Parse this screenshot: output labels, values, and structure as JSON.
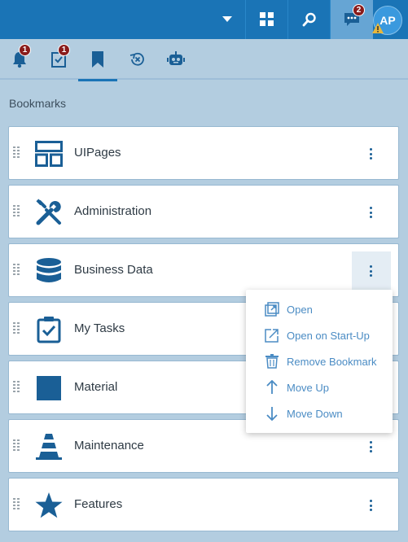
{
  "topbar": {
    "chat_badge": "2",
    "avatar_initials": "AP"
  },
  "tabs": [
    {
      "name": "notifications",
      "badge": "1"
    },
    {
      "name": "tasks",
      "badge": "1"
    },
    {
      "name": "bookmarks",
      "active": true
    },
    {
      "name": "recent"
    },
    {
      "name": "assistant"
    }
  ],
  "bookmarks": {
    "title": "Bookmarks",
    "items": [
      {
        "label": "UIPages",
        "icon": "layout-icon"
      },
      {
        "label": "Administration",
        "icon": "tools-icon"
      },
      {
        "label": "Business Data",
        "icon": "database-icon"
      },
      {
        "label": "My Tasks",
        "icon": "clipboard-check-icon"
      },
      {
        "label": "Material",
        "icon": "square-icon"
      },
      {
        "label": "Maintenance",
        "icon": "cone-icon"
      },
      {
        "label": "Features",
        "icon": "star-icon"
      }
    ]
  },
  "context_menu": {
    "items": [
      {
        "label": "Open",
        "icon": "open-icon"
      },
      {
        "label": "Open on Start-Up",
        "icon": "external-icon"
      },
      {
        "label": "Remove Bookmark",
        "icon": "trash-icon"
      },
      {
        "label": "Move Up",
        "icon": "arrow-up-icon"
      },
      {
        "label": "Move Down",
        "icon": "arrow-down-icon"
      }
    ]
  },
  "colors": {
    "brand": "#1a74b6",
    "icon": "#1a5f96",
    "menu_text": "#4b8cc4",
    "badge": "#8a1c1c",
    "panel": "#b3cde0"
  }
}
